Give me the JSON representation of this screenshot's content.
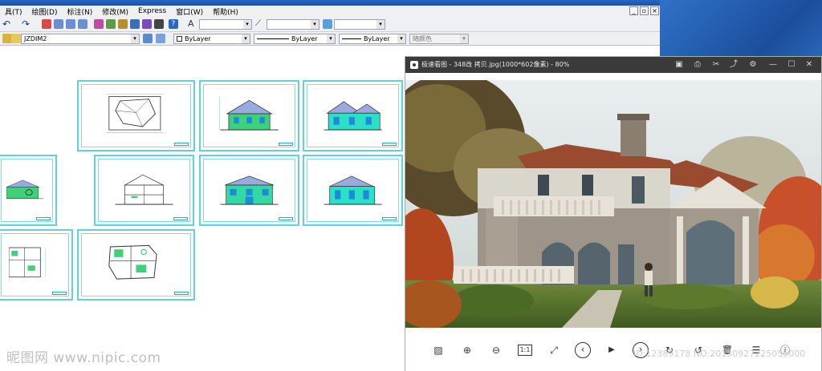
{
  "cad": {
    "menu": [
      "具(T)",
      "绘图(D)",
      "标注(N)",
      "修改(M)",
      "Express",
      "窗口(W)",
      "帮助(H)"
    ],
    "window_controls": [
      "_",
      "▫",
      "×"
    ],
    "toolbar": {
      "dimstyle": "JZDIM2",
      "layer": "ByLayer",
      "linetype": "ByLayer",
      "lineweight": "ByLayer",
      "plotstyle": "随颜色"
    }
  },
  "viewer": {
    "title": "极速看图 - 348改 拷贝.jpg(1000*602像素) - 80%",
    "title_icons": [
      "save-icon",
      "print-icon",
      "scissors-icon",
      "share-icon",
      "settings-icon",
      "minimize-icon",
      "maximize-icon",
      "close-icon"
    ],
    "toolbar_buttons": [
      {
        "name": "image-icon",
        "glyph": "▨"
      },
      {
        "name": "zoom-in-icon",
        "glyph": "⊕"
      },
      {
        "name": "zoom-out-icon",
        "glyph": "⊖"
      },
      {
        "name": "actual-size-icon",
        "glyph": "1:1"
      },
      {
        "name": "fullscreen-icon",
        "glyph": "⤢"
      },
      {
        "name": "previous-icon",
        "glyph": "‹"
      },
      {
        "name": "slideshow-icon",
        "glyph": "▶"
      },
      {
        "name": "next-icon",
        "glyph": "›"
      },
      {
        "name": "rotate-right-icon",
        "glyph": "↻"
      },
      {
        "name": "rotate-left-icon",
        "glyph": "↺"
      },
      {
        "name": "delete-icon",
        "glyph": "🗑"
      },
      {
        "name": "menu-icon",
        "glyph": "☰"
      },
      {
        "name": "info-icon",
        "glyph": "ⓘ"
      }
    ]
  },
  "watermark": {
    "left": "昵图网 www.nipic.com",
    "right": "ID:12389178 NO:20150927225055000"
  },
  "colors": {
    "viewer_title_bg": "#3a3a3a",
    "cad_sheet_border": "#5fd3dc",
    "desktop_blue": "#2f72c9"
  }
}
